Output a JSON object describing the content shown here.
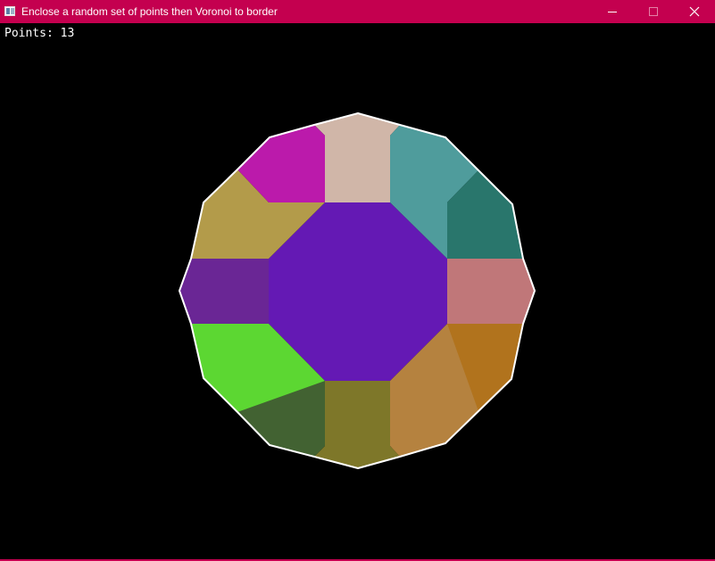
{
  "window": {
    "title": "Enclose a random set of points then Voronoi to border",
    "accent_color": "#c4004f",
    "buttons": {
      "minimize_icon": "minimize-icon",
      "maximize_icon": "maximize-icon",
      "close_icon": "close-icon"
    }
  },
  "canvas": {
    "background": "#000000",
    "points_label": "Points: 13",
    "border_color": "#ffffff",
    "cells": [
      {
        "name": "center-cell",
        "color": "#6419b4"
      },
      {
        "name": "top-cell",
        "color": "#d0b6a8"
      },
      {
        "name": "top-right-cell",
        "color": "#4f9c9c"
      },
      {
        "name": "right-upper-cell",
        "color": "#29766c"
      },
      {
        "name": "right-cell",
        "color": "#c07779"
      },
      {
        "name": "right-lower-cell",
        "color": "#b1731d"
      },
      {
        "name": "bottom-right-cell",
        "color": "#b5823f"
      },
      {
        "name": "bottom-cell",
        "color": "#7e7729"
      },
      {
        "name": "bottom-left-cell",
        "color": "#426232"
      },
      {
        "name": "left-lower-cell",
        "color": "#5cd732"
      },
      {
        "name": "left-cell",
        "color": "#6a2695"
      },
      {
        "name": "left-upper-cell",
        "color": "#b39b4a"
      },
      {
        "name": "top-left-cell",
        "color": "#bb1aab"
      }
    ]
  }
}
